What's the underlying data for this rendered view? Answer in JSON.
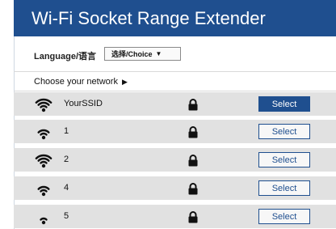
{
  "header": {
    "title": "Wi-Fi Socket Range Extender"
  },
  "language": {
    "label": "Language/语言",
    "select_value": "选择/Choice"
  },
  "network": {
    "label": "Choose your network"
  },
  "networks": [
    {
      "ssid": "YourSSID",
      "signal": "full",
      "select_label": "Select",
      "highlighted": true
    },
    {
      "ssid": "1",
      "signal": "high",
      "select_label": "Select",
      "highlighted": false
    },
    {
      "ssid": "2",
      "signal": "full",
      "select_label": "Select",
      "highlighted": false
    },
    {
      "ssid": "4",
      "signal": "high",
      "select_label": "Select",
      "highlighted": false
    },
    {
      "ssid": "5",
      "signal": "medium",
      "select_label": "Select",
      "highlighted": false
    }
  ],
  "colors": {
    "accent": "#1f4f8f",
    "row_bg": "#e1e1e1"
  },
  "icons": {
    "signal": "wifi-icon",
    "security": "lock-icon",
    "dropdown": "triangle-down-icon",
    "expand": "triangle-right-icon"
  }
}
